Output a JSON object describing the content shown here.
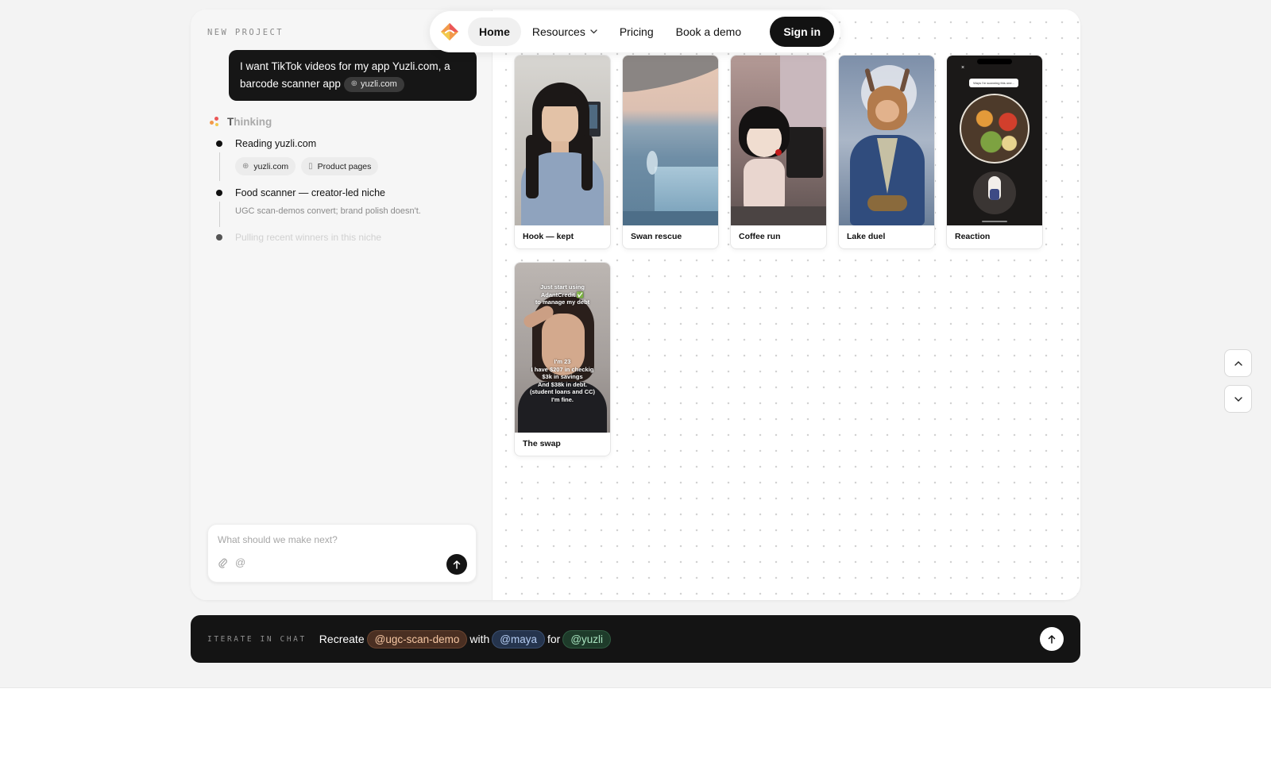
{
  "nav": {
    "items": [
      {
        "label": "Home",
        "active": true
      },
      {
        "label": "Resources",
        "dropdown": true
      },
      {
        "label": "Pricing"
      },
      {
        "label": "Book a demo"
      }
    ],
    "signin_label": "Sign in"
  },
  "project": {
    "label": "NEW PROJECT",
    "user_message": "I want TikTok videos for my app Yuzli.com, a barcode scanner app",
    "user_chip": "yuzli.com"
  },
  "thinking": {
    "title_first": "T",
    "title_rest": "hinking",
    "steps": [
      {
        "title": "Reading yuzli.com",
        "chips": [
          "yuzli.com",
          "Product pages"
        ]
      },
      {
        "title": "Food scanner — creator-led niche",
        "subtitle": "UGC scan-demos convert; brand polish doesn't."
      },
      {
        "title": "Pulling recent winners in this niche",
        "faded": true
      }
    ]
  },
  "composer": {
    "placeholder": "What should we make next?",
    "attach_icon": "paperclip-icon",
    "mention_symbol": "@"
  },
  "videos": [
    {
      "label": "Hook — kept"
    },
    {
      "label": "Swan rescue"
    },
    {
      "label": "Coffee run"
    },
    {
      "label": "Lake duel"
    },
    {
      "label": "Reaction"
    },
    {
      "label": "The swap"
    }
  ],
  "overlays": {
    "reaction_top": "Ways I'm scanning this one...",
    "reaction_close": "×",
    "swap_top": "Just start using\nAdantCredit ✅\nto manage my debt",
    "swap_bottom": "I'm 23\nI have $207 in checkig\n$3k in savings\nAnd $38k in debt.\n(student loans and CC)\nI'm fine."
  },
  "iterate": {
    "label": "ITERATE IN CHAT",
    "word_recreate": "Recreate",
    "token_format": "@ugc-scan-demo",
    "word_with": "with",
    "token_creator": "@maya",
    "word_for": "for",
    "token_brand": "@yuzli"
  },
  "colors": {
    "accent_dark": "#141414",
    "token_format": "#f6c7a3",
    "token_creator": "#b5cdf3",
    "token_brand": "#a8e3bf"
  }
}
